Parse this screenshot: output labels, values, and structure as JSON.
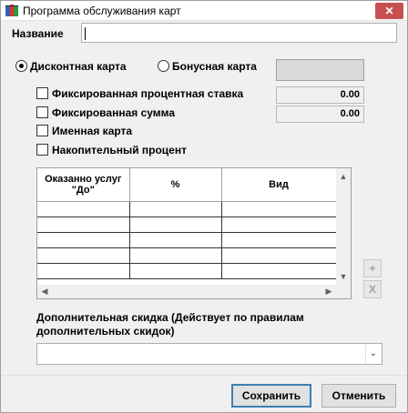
{
  "window": {
    "title": "Программа обслуживания карт",
    "close_label": "✕"
  },
  "name_field": {
    "label": "Название",
    "value": ""
  },
  "card_type": {
    "options": [
      {
        "label": "Дисконтная карта",
        "selected": true
      },
      {
        "label": "Бонусная карта",
        "selected": false
      }
    ],
    "color_swatch": "#d9d9d9"
  },
  "checkboxes": [
    {
      "label": "Фиксированная процентная ставка",
      "checked": false,
      "value": "0.00"
    },
    {
      "label": "Фиксированная сумма",
      "checked": false,
      "value": "0.00"
    },
    {
      "label": "Именная карта",
      "checked": false
    },
    {
      "label": "Накопительный процент",
      "checked": false
    }
  ],
  "table": {
    "columns": [
      "Оказанно услуг \"До\"",
      "%",
      "Вид"
    ],
    "rows": [
      [
        "",
        "",
        ""
      ],
      [
        "",
        "",
        ""
      ],
      [
        "",
        "",
        ""
      ],
      [
        "",
        "",
        ""
      ],
      [
        "",
        "",
        ""
      ]
    ]
  },
  "side_buttons": {
    "add": "+",
    "remove": "X"
  },
  "extra_discount": {
    "label": "Дополнительная скидка (Действует по правилам дополнительных скидок)",
    "value": ""
  },
  "buttons": {
    "save": "Сохранить",
    "cancel": "Отменить"
  }
}
